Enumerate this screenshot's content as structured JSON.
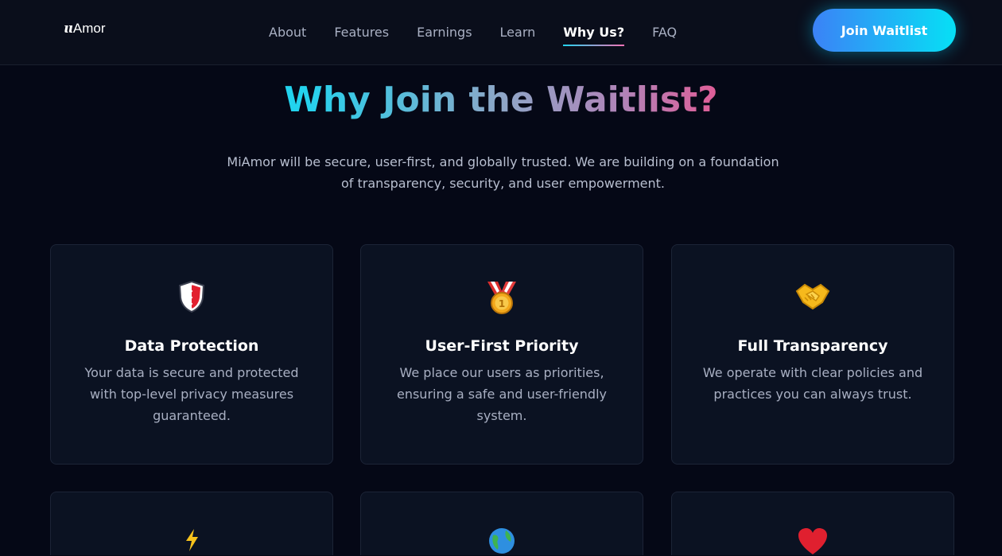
{
  "nav": {
    "logo_mark": "ɩɩ",
    "logo_text": "Amor",
    "links": [
      {
        "label": "About"
      },
      {
        "label": "Features"
      },
      {
        "label": "Earnings"
      },
      {
        "label": "Learn"
      },
      {
        "label": "Why Us?",
        "active": true
      },
      {
        "label": "FAQ"
      }
    ],
    "cta_label": "Join Waitlist"
  },
  "hero": {
    "title": "Why Join the Waitlist?",
    "subtitle": "MiAmor will be secure, user-first, and globally trusted. We are building on a foundation of transparency, security, and user empowerment."
  },
  "cards": [
    {
      "icon": "shield-icon",
      "title": "Data Protection",
      "desc": "Your data is secure and protected with top-level privacy measures guaranteed."
    },
    {
      "icon": "medal-icon",
      "title": "User-First Priority",
      "desc": "We place our users as priorities, ensuring a safe and user-friendly system."
    },
    {
      "icon": "handshake-icon",
      "title": "Full Transparency",
      "desc": "We operate with clear policies and practices you can always trust."
    }
  ],
  "peek_cards": [
    {
      "icon": "lightning-icon"
    },
    {
      "icon": "globe-icon"
    },
    {
      "icon": "heart-icon"
    }
  ],
  "colors": {
    "background": "#050816",
    "accent_cyan": "#06e0f5",
    "accent_blue": "#3b82f6",
    "accent_pink": "#f0508c"
  }
}
